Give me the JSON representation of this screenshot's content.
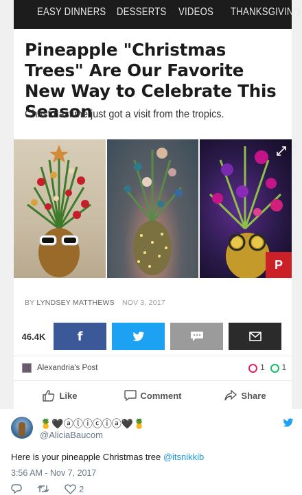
{
  "article_nav": {
    "items": [
      "EASY DINNERS",
      "DESSERTS",
      "VIDEOS",
      "THANKSGIVING"
    ]
  },
  "article": {
    "headline": "Pineapple \"Christmas Trees\" Are Our Favorite New Way to Celebrate This Season",
    "subhead": "Christmastime just got a visit from the tropics.",
    "byline_prefix": "BY",
    "author": "LYNDSEY MATTHEWS",
    "date": "NOV 3, 2017",
    "pin_label": "P"
  },
  "share": {
    "count": "46.4K",
    "facebook_label": "f",
    "icons": [
      "facebook-icon",
      "twitter-icon",
      "sms-icon",
      "mail-icon"
    ]
  },
  "post": {
    "page_name": "Alexandria's Post",
    "hearts": "1",
    "comments": "1",
    "like_label": "Like",
    "comment_label": "Comment",
    "share_label": "Share"
  },
  "tweet": {
    "display_name": "🍍🖤ⓐⓛⓘⓒⓘⓐ🖤🍍",
    "handle": "@AliciaBaucom",
    "text": "Here is your pineapple Christmas tree ",
    "mention": "@itsnikkib",
    "timestamp": "3:56 AM - Nov 7, 2017",
    "like_count": "2"
  },
  "colors": {
    "facebook": "#3b5998",
    "twitter": "#1da1f2",
    "sms": "#9b9b9b",
    "mail": "#2b2b2b",
    "pinterest": "#cb2027",
    "mention": "#1b95e0"
  }
}
